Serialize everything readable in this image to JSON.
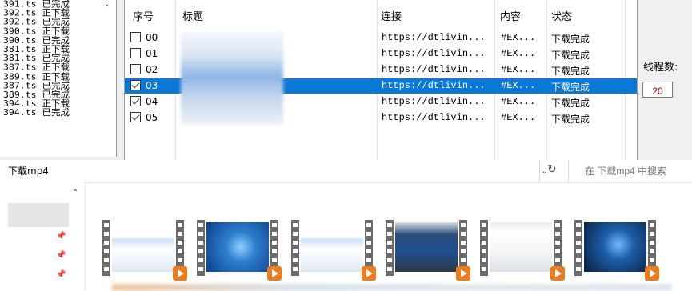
{
  "log": {
    "lines": [
      "391.ts 已完成",
      "392.ts 正下载",
      "392.ts 已完成",
      "390.ts 正下载",
      "390.ts 已完成",
      "381.ts 正下载",
      "381.ts 已完成",
      "387.ts 正下载",
      "389.ts 正下载",
      "387.ts 已完成",
      "389.ts 已完成",
      "394.ts 正下载",
      "394.ts 已完成"
    ],
    "scroll_up_glyph": "⌃"
  },
  "table": {
    "headers": [
      "序号",
      "标题",
      "连接",
      "内容",
      "状态"
    ],
    "rows": [
      {
        "no": "00",
        "link": "https://dtlivin...",
        "content": "#EX...",
        "status": "下载完成",
        "checked": false,
        "selected": false
      },
      {
        "no": "01",
        "link": "https://dtlivin...",
        "content": "#EX...",
        "status": "下载完成",
        "checked": false,
        "selected": false
      },
      {
        "no": "02",
        "link": "https://dtlivin...",
        "content": "#EX...",
        "status": "下载完成",
        "checked": false,
        "selected": false
      },
      {
        "no": "03",
        "link": "https://dtlivin...",
        "content": "#EX...",
        "status": "下载完成",
        "checked": true,
        "selected": true
      },
      {
        "no": "04",
        "link": "https://dtlivin...",
        "content": "#EX...",
        "status": "下载完成",
        "checked": true,
        "selected": false
      },
      {
        "no": "05",
        "link": "https://dtlivin...",
        "content": "#EX...",
        "status": "下载完成",
        "checked": true,
        "selected": false
      }
    ]
  },
  "threads": {
    "label": "线程数:",
    "value": "20"
  },
  "explorer": {
    "path": "下载mp4",
    "dropdown_glyph": "⌄",
    "refresh_glyph": "↻",
    "search_placeholder": "在 下载mp4 中搜索",
    "nav_up_glyph": "⌃",
    "pin_glyph": "📌"
  },
  "colors": {
    "selection": "#0b78d7",
    "thread_value": "#c00000",
    "play_badge": "#f07b1a"
  },
  "thumbnails": [
    {
      "name": "video-1",
      "theme": "light-app"
    },
    {
      "name": "video-2",
      "theme": "windows7-desktop"
    },
    {
      "name": "video-3",
      "theme": "light-app"
    },
    {
      "name": "video-4",
      "theme": "dark-presentation"
    },
    {
      "name": "video-5",
      "theme": "document"
    },
    {
      "name": "video-6",
      "theme": "dark-desktop"
    }
  ]
}
